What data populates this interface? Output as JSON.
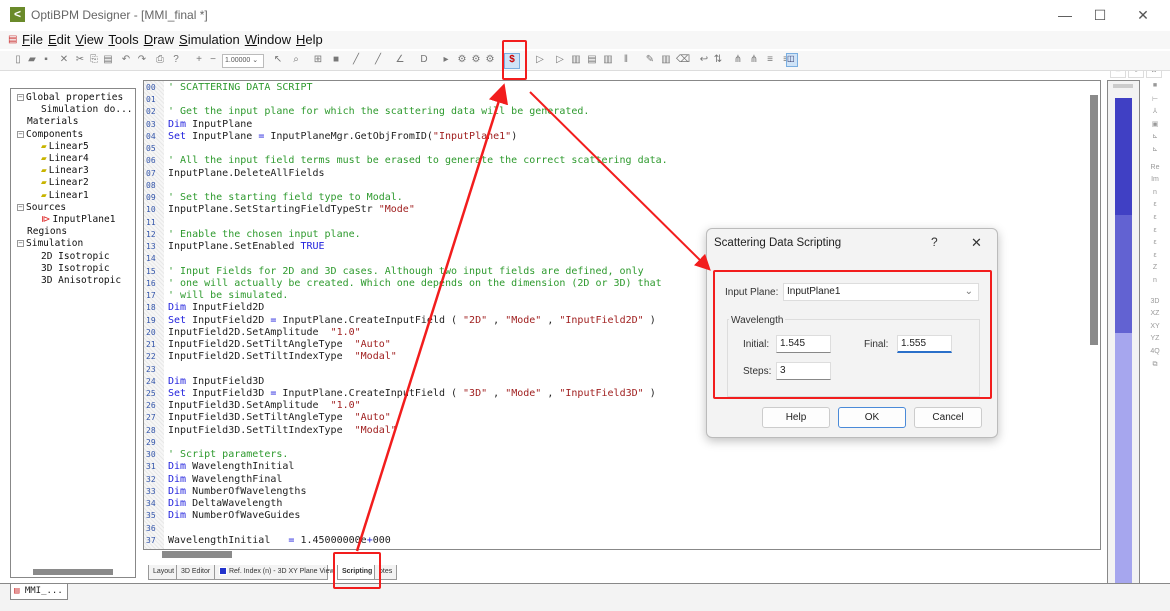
{
  "window": {
    "title": "OptiBPM Designer  - [MMI_final *]",
    "logo_glyph": "<",
    "minimize": "—",
    "maximize": "☐",
    "close": "✕"
  },
  "menu": [
    "File",
    "Edit",
    "View",
    "Tools",
    "Draw",
    "Simulation",
    "Window",
    "Help"
  ],
  "toolbar": {
    "zoom_value": "1.00000",
    "highlighted_button": "scattering-data-script-icon"
  },
  "tree": [
    {
      "label": "Global properties",
      "level": 0,
      "expand": "−"
    },
    {
      "label": "Simulation do...",
      "level": 1
    },
    {
      "label": "Materials",
      "level": 0
    },
    {
      "label": "Components",
      "level": 0,
      "expand": "−"
    },
    {
      "label": "Linear5",
      "level": 1,
      "icon": "waveguide-icon"
    },
    {
      "label": "Linear4",
      "level": 1,
      "icon": "waveguide-icon"
    },
    {
      "label": "Linear3",
      "level": 1,
      "icon": "waveguide-icon"
    },
    {
      "label": "Linear2",
      "level": 1,
      "icon": "waveguide-icon"
    },
    {
      "label": "Linear1",
      "level": 1,
      "icon": "waveguide-icon"
    },
    {
      "label": "Sources",
      "level": 0,
      "expand": "−"
    },
    {
      "label": "InputPlane1",
      "level": 1,
      "icon": "input-plane-icon"
    },
    {
      "label": "Regions",
      "level": 0
    },
    {
      "label": "Simulation",
      "level": 0,
      "expand": "−"
    },
    {
      "label": "2D Isotropic",
      "level": 1
    },
    {
      "label": "3D Isotropic",
      "level": 1
    },
    {
      "label": "3D Anisotropic",
      "level": 1
    }
  ],
  "code": [
    {
      "num": "00",
      "segs": [
        [
          "c",
          "' SCATTERING DATA SCRIPT"
        ]
      ]
    },
    {
      "num": "01",
      "segs": []
    },
    {
      "num": "02",
      "segs": [
        [
          "c",
          "' Get the input plane for which the scattering data will be generated."
        ]
      ]
    },
    {
      "num": "03",
      "segs": [
        [
          "k",
          "Dim"
        ],
        [
          "n",
          " InputPlane"
        ]
      ]
    },
    {
      "num": "04",
      "segs": [
        [
          "k",
          "Set"
        ],
        [
          "n",
          " InputPlane "
        ],
        [
          "k",
          "="
        ],
        [
          "n",
          " InputPlaneMgr.GetObjFromID("
        ],
        [
          "s",
          "\"InputPlane1\""
        ],
        [
          "n",
          ")"
        ]
      ]
    },
    {
      "num": "05",
      "segs": []
    },
    {
      "num": "06",
      "segs": [
        [
          "c",
          "' All the input field terms must be erased to generate the correct scattering data."
        ]
      ]
    },
    {
      "num": "07",
      "segs": [
        [
          "n",
          "InputPlane.DeleteAllFields"
        ]
      ]
    },
    {
      "num": "08",
      "segs": []
    },
    {
      "num": "09",
      "segs": [
        [
          "c",
          "' Set the starting field type to Modal."
        ]
      ]
    },
    {
      "num": "10",
      "segs": [
        [
          "n",
          "InputPlane.SetStartingFieldTypeStr "
        ],
        [
          "s",
          "\"Mode\""
        ]
      ]
    },
    {
      "num": "11",
      "segs": []
    },
    {
      "num": "12",
      "segs": [
        [
          "c",
          "' Enable the chosen input plane."
        ]
      ]
    },
    {
      "num": "13",
      "segs": [
        [
          "n",
          "InputPlane.SetEnabled "
        ],
        [
          "k",
          "TRUE"
        ]
      ]
    },
    {
      "num": "14",
      "segs": []
    },
    {
      "num": "15",
      "segs": [
        [
          "c",
          "' Input Fields for 2D and 3D cases. Although two input fields are defined, only"
        ]
      ]
    },
    {
      "num": "16",
      "segs": [
        [
          "c",
          "' one will actually be created. Which one depends on the dimension (2D or 3D) that"
        ]
      ]
    },
    {
      "num": "17",
      "segs": [
        [
          "c",
          "' will be simulated."
        ]
      ]
    },
    {
      "num": "18",
      "segs": [
        [
          "k",
          "Dim"
        ],
        [
          "n",
          " InputField2D"
        ]
      ]
    },
    {
      "num": "19",
      "segs": [
        [
          "k",
          "Set"
        ],
        [
          "n",
          " InputField2D "
        ],
        [
          "k",
          "="
        ],
        [
          "n",
          " InputPlane.CreateInputField ( "
        ],
        [
          "s",
          "\"2D\""
        ],
        [
          "n",
          " , "
        ],
        [
          "s",
          "\"Mode\""
        ],
        [
          "n",
          " , "
        ],
        [
          "s",
          "\"InputField2D\""
        ],
        [
          "n",
          " )"
        ]
      ]
    },
    {
      "num": "20",
      "segs": [
        [
          "n",
          "InputField2D.SetAmplitude  "
        ],
        [
          "s",
          "\"1.0\""
        ]
      ]
    },
    {
      "num": "21",
      "segs": [
        [
          "n",
          "InputField2D.SetTiltAngleType  "
        ],
        [
          "s",
          "\"Auto\""
        ]
      ]
    },
    {
      "num": "22",
      "segs": [
        [
          "n",
          "InputField2D.SetTiltIndexType  "
        ],
        [
          "s",
          "\"Modal\""
        ]
      ]
    },
    {
      "num": "23",
      "segs": []
    },
    {
      "num": "24",
      "segs": [
        [
          "k",
          "Dim"
        ],
        [
          "n",
          " InputField3D"
        ]
      ]
    },
    {
      "num": "25",
      "segs": [
        [
          "k",
          "Set"
        ],
        [
          "n",
          " InputField3D "
        ],
        [
          "k",
          "="
        ],
        [
          "n",
          " InputPlane.CreateInputField ( "
        ],
        [
          "s",
          "\"3D\""
        ],
        [
          "n",
          " , "
        ],
        [
          "s",
          "\"Mode\""
        ],
        [
          "n",
          " , "
        ],
        [
          "s",
          "\"InputField3D\""
        ],
        [
          "n",
          " )"
        ]
      ]
    },
    {
      "num": "26",
      "segs": [
        [
          "n",
          "InputField3D.SetAmplitude  "
        ],
        [
          "s",
          "\"1.0\""
        ]
      ]
    },
    {
      "num": "27",
      "segs": [
        [
          "n",
          "InputField3D.SetTiltAngleType  "
        ],
        [
          "s",
          "\"Auto\""
        ]
      ]
    },
    {
      "num": "28",
      "segs": [
        [
          "n",
          "InputField3D.SetTiltIndexType  "
        ],
        [
          "s",
          "\"Modal\""
        ]
      ]
    },
    {
      "num": "29",
      "segs": []
    },
    {
      "num": "30",
      "segs": [
        [
          "c",
          "' Script parameters."
        ]
      ]
    },
    {
      "num": "31",
      "segs": [
        [
          "k",
          "Dim"
        ],
        [
          "n",
          " WavelengthInitial"
        ]
      ]
    },
    {
      "num": "32",
      "segs": [
        [
          "k",
          "Dim"
        ],
        [
          "n",
          " WavelengthFinal"
        ]
      ]
    },
    {
      "num": "33",
      "segs": [
        [
          "k",
          "Dim"
        ],
        [
          "n",
          " NumberOfWavelengths"
        ]
      ]
    },
    {
      "num": "34",
      "segs": [
        [
          "k",
          "Dim"
        ],
        [
          "n",
          " DeltaWavelength"
        ]
      ]
    },
    {
      "num": "35",
      "segs": [
        [
          "k",
          "Dim"
        ],
        [
          "n",
          " NumberOfWaveGuides"
        ]
      ]
    },
    {
      "num": "36",
      "segs": []
    },
    {
      "num": "37",
      "segs": [
        [
          "n",
          "WavelengthInitial   "
        ],
        [
          "k",
          "="
        ],
        [
          "n",
          " 1.45000000e"
        ],
        [
          "k",
          "+"
        ],
        [
          "n",
          "000"
        ]
      ]
    }
  ],
  "view_tabs": [
    "Layout",
    "3D Editor",
    "Ref. Index (n) - 3D XY Plane View",
    "Scripting",
    "otes"
  ],
  "active_view_tab": "Scripting",
  "doc_tab": "MMI_...",
  "right_toolbar": [
    "■",
    "⊢",
    "⅄",
    "▣",
    "⊾",
    "⊾",
    "Re",
    "Im",
    "n",
    "ε",
    "ε",
    "ε",
    "ε",
    "ε",
    "Z",
    "n",
    "3D",
    "XZ",
    "XY",
    "YZ",
    "4Q",
    "⧉"
  ],
  "colorbar_colors": [
    "#4040c4",
    "#6262d2",
    "#a6a6ee"
  ],
  "dialog": {
    "title": "Scattering Data Scripting",
    "help_icon": "?",
    "close_icon": "✕",
    "input_plane_label": "Input Plane:",
    "input_plane_value": "InputPlane1",
    "wavelength_group": "Wavelength",
    "initial_label": "Initial:",
    "initial_value": "1.545",
    "final_label": "Final:",
    "final_value": "1.555",
    "steps_label": "Steps:",
    "steps_value": "3",
    "help_button": "Help",
    "ok_button": "OK",
    "cancel_button": "Cancel"
  },
  "annotation_color": "#f21d1d"
}
